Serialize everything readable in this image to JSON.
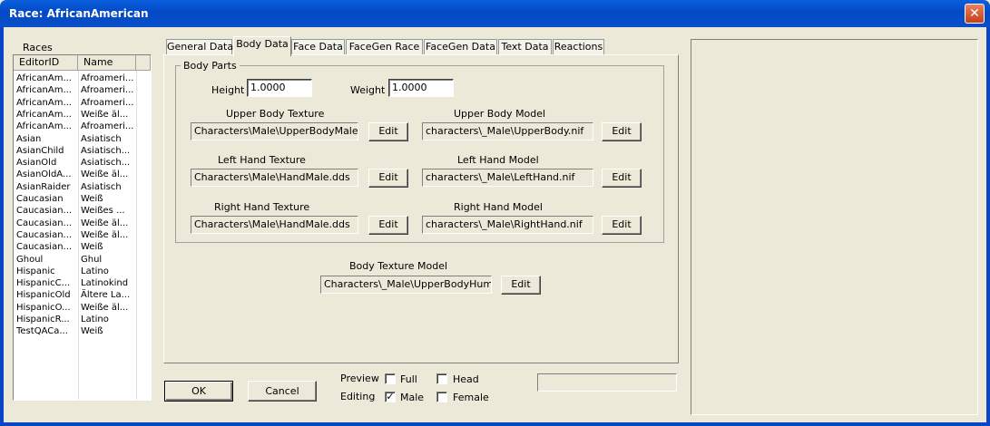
{
  "window": {
    "title": "Race: AfricanAmerican",
    "close_glyph": "✕"
  },
  "races": {
    "group_label": "Races",
    "columns": [
      "EditorID",
      "Name"
    ],
    "rows": [
      [
        "AfricanAm...",
        "Afroameri..."
      ],
      [
        "AfricanAm...",
        "Afroameri..."
      ],
      [
        "AfricanAm...",
        "Afroameri..."
      ],
      [
        "AfricanAm...",
        "Weiße äl..."
      ],
      [
        "AfricanAm...",
        "Afroameri..."
      ],
      [
        "Asian",
        "Asiatisch"
      ],
      [
        "AsianChild",
        "Asiatisch..."
      ],
      [
        "AsianOld",
        "Asiatisch..."
      ],
      [
        "AsianOldA...",
        "Weiße äl..."
      ],
      [
        "AsianRaider",
        "Asiatisch"
      ],
      [
        "Caucasian",
        "Weiß"
      ],
      [
        "Caucasian...",
        "Weißes ..."
      ],
      [
        "Caucasian...",
        "Weiße äl..."
      ],
      [
        "Caucasian...",
        "Weiße äl..."
      ],
      [
        "Caucasian...",
        "Weiß"
      ],
      [
        "Ghoul",
        "Ghul"
      ],
      [
        "Hispanic",
        "Latino"
      ],
      [
        "HispanicC...",
        "Latinokind"
      ],
      [
        "HispanicOld",
        "Ältere La..."
      ],
      [
        "HispanicO...",
        "Weiße äl..."
      ],
      [
        "HispanicR...",
        "Latino"
      ],
      [
        "TestQACa...",
        "Weiß"
      ]
    ]
  },
  "tabs": [
    "General Data",
    "Body Data",
    "Face Data",
    "FaceGen Race",
    "FaceGen Data",
    "Text Data",
    "Reactions"
  ],
  "body": {
    "group_label": "Body Parts",
    "height_label": "Height",
    "height_value": "1.0000",
    "weight_label": "Weight",
    "weight_value": "1.0000",
    "upper_texture_label": "Upper Body Texture",
    "upper_texture_value": "Characters\\Male\\UpperBodyMale.dds",
    "upper_model_label": "Upper Body Model",
    "upper_model_value": "characters\\_Male\\UpperBody.nif",
    "left_texture_label": "Left Hand Texture",
    "left_texture_value": "Characters\\Male\\HandMale.dds",
    "left_model_label": "Left Hand Model",
    "left_model_value": "characters\\_Male\\LeftHand.nif",
    "right_texture_label": "Right Hand Texture",
    "right_texture_value": "Characters\\Male\\HandMale.dds",
    "right_model_label": "Right Hand Model",
    "right_model_value": "characters\\_Male\\RightHand.nif",
    "body_texture_model_label": "Body Texture Model",
    "body_texture_model_value": "Characters\\_Male\\UpperBodyHuman",
    "edit_label": "Edit"
  },
  "footer": {
    "ok_label": "OK",
    "cancel_label": "Cancel",
    "preview_label": "Preview",
    "editing_label": "Editing",
    "full_label": "Full",
    "head_label": "Head",
    "male_label": "Male",
    "female_label": "Female",
    "check_glyph": "✓"
  }
}
